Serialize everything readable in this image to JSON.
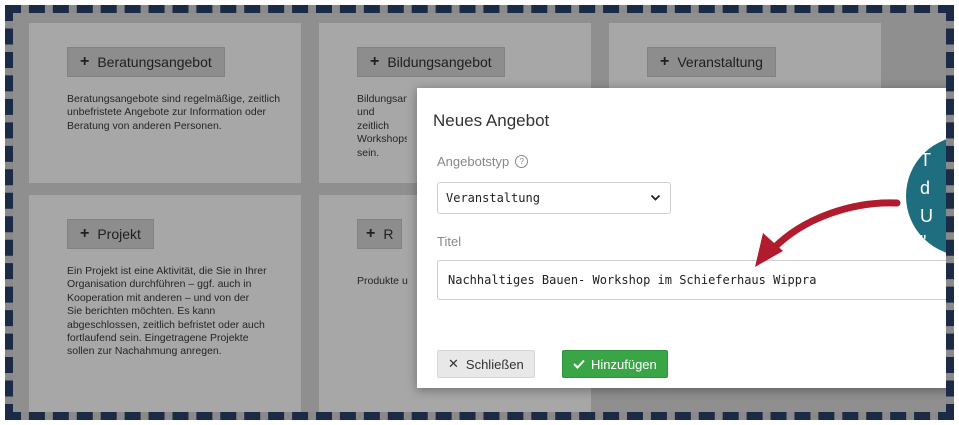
{
  "cards": [
    {
      "button": "Beratungsangebot",
      "text": "Beratungsangebote sind regelmäßige, zeitlich unbefristete Angebote zur Information oder Beratung von anderen Personen."
    },
    {
      "button": "Bildungsangebot",
      "text": "Bildungsan und zeitlich Workshops sein."
    },
    {
      "button": "Veranstaltung",
      "text": ""
    },
    {
      "button": "Projekt",
      "text": "Ein Projekt ist eine Aktivität, die Sie in Ihrer Organisation durchführen – ggf. auch in Kooperation mit anderen – und von der Sie berichten möchten. Es kann abgeschlossen, zeitlich befristet oder auch fortlaufend sein. Eingetragene Projekte sollen zur Nachahmung anregen."
    },
    {
      "button": "R",
      "text": "Produkte u"
    }
  ],
  "dialog": {
    "title": "Neues Angebot",
    "type_label": "Angebotstyp",
    "type_value": "Veranstaltung",
    "title_label": "Titel",
    "title_value": "Nachhaltiges Bauen- Workshop im Schieferhaus Wippra",
    "close_label": "Schließen",
    "add_label": "Hinzufügen"
  },
  "callout": {
    "lines": [
      "T",
      "d",
      "U",
      "\""
    ],
    "color": "#1f6e80"
  },
  "colors": {
    "arrow": "#b01c2e",
    "add_button": "#3aa547",
    "frame": "#1b2b45"
  },
  "icons": {
    "info": "info-icon",
    "chevron": "chevron-down-icon",
    "close": "close-icon",
    "check": "check-icon",
    "plus": "plus-icon",
    "arrow": "curved-arrow-icon"
  }
}
